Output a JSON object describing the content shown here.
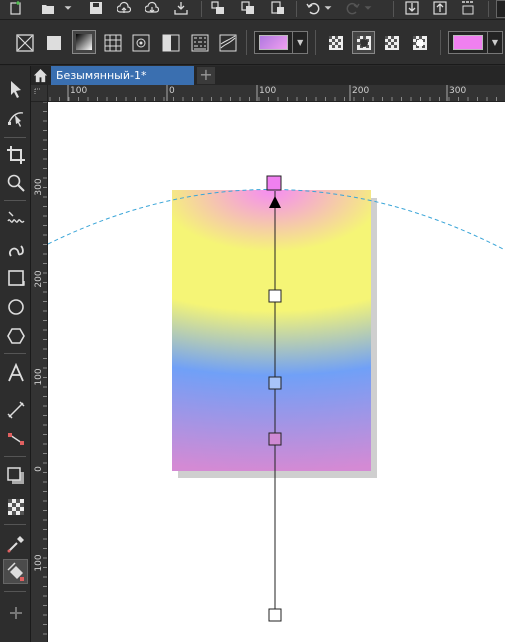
{
  "document": {
    "tab_title": "Безымянный-1*"
  },
  "rulers": {
    "horizontal": [
      "0",
      "100",
      "0",
      "100",
      "200",
      "300"
    ],
    "vertical": [
      "300",
      "200",
      "100",
      "0",
      "100"
    ]
  },
  "gradient": {
    "stops": [
      {
        "position": 0.0,
        "color": "#f58cf3"
      },
      {
        "position": 0.22,
        "color": "#f5f576"
      },
      {
        "position": 0.43,
        "color": "#f5f576"
      },
      {
        "position": 0.66,
        "color": "#70a0f7"
      },
      {
        "position": 1.0,
        "color": "#d48ad4"
      }
    ]
  },
  "colors": {
    "accent": "#3a6fb0",
    "fill_swatch": "#f080f0",
    "gradient_swatch_start": "#b078e0",
    "gradient_swatch_end": "#f0a0f0",
    "guide_curve": "#3aa5d8"
  }
}
